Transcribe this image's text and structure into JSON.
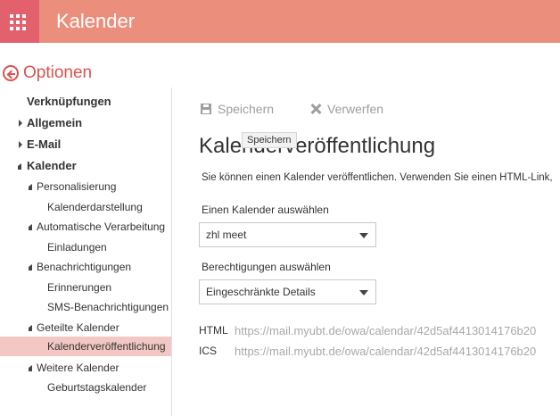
{
  "header": {
    "app_title": "Kalender"
  },
  "options": {
    "label": "Optionen"
  },
  "sidebar": {
    "items": [
      {
        "label": "Verknüpfungen"
      },
      {
        "label": "Allgemein"
      },
      {
        "label": "E-Mail"
      },
      {
        "label": "Kalender"
      },
      {
        "label": "Personalisierung"
      },
      {
        "label": "Kalenderdarstellung"
      },
      {
        "label": "Automatische Verarbeitung"
      },
      {
        "label": "Einladungen"
      },
      {
        "label": "Benachrichtigungen"
      },
      {
        "label": "Erinnerungen"
      },
      {
        "label": "SMS-Benachrichtigungen"
      },
      {
        "label": "Geteilte Kalender"
      },
      {
        "label": "Kalenderveröffentlichung"
      },
      {
        "label": "Weitere Kalender"
      },
      {
        "label": "Geburtstagskalender"
      }
    ]
  },
  "toolbar": {
    "save_label": "Speichern",
    "discard_label": "Verwerfen",
    "tooltip": "Speichern"
  },
  "main": {
    "title": "Kalenderveröffentlichung",
    "description": "Sie können einen Kalender veröffentlichen. Verwenden Sie einen HTML-Link,",
    "calendar_select": {
      "label": "Einen Kalender auswählen",
      "value": "zhl meet"
    },
    "permission_select": {
      "label": "Berechtigungen auswählen",
      "value": "Eingeschränkte Details"
    },
    "links": [
      {
        "label": "HTML",
        "url": "https://mail.myubt.de/owa/calendar/42d5af4413014176b20"
      },
      {
        "label": "ICS",
        "url": "https://mail.myubt.de/owa/calendar/42d5af4413014176b20"
      }
    ]
  },
  "colors": {
    "header": "#eb8f7c",
    "waffle": "#e3616d",
    "accent": "#d9534f",
    "selected": "#f3c8c4"
  }
}
